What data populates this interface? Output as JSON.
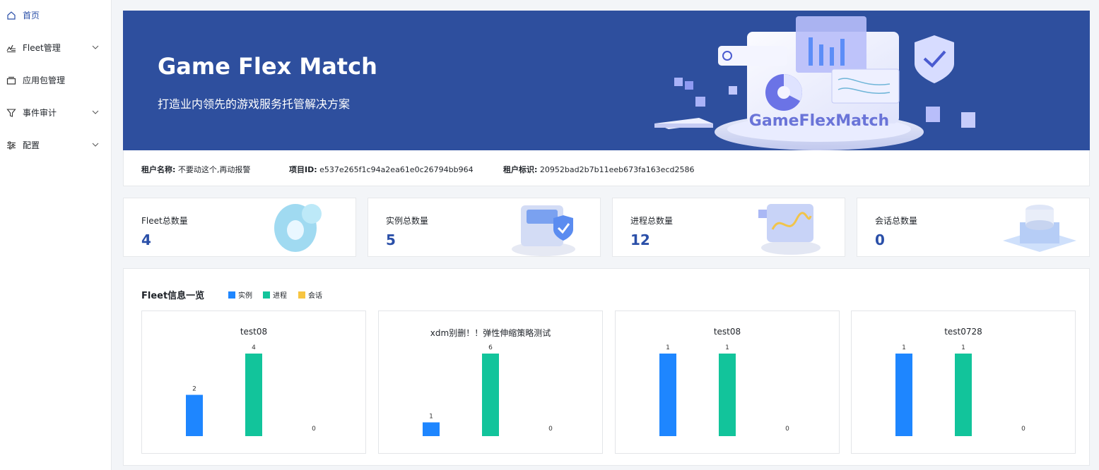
{
  "sidebar": {
    "items": [
      {
        "label": "首页",
        "icon": "home-icon",
        "active": true
      },
      {
        "label": "Fleet管理",
        "icon": "fleet-icon",
        "expandable": true
      },
      {
        "label": "应用包管理",
        "icon": "package-icon"
      },
      {
        "label": "事件审计",
        "icon": "filter-icon",
        "expandable": true
      },
      {
        "label": "配置",
        "icon": "sliders-icon",
        "expandable": true
      }
    ]
  },
  "banner": {
    "title": "Game Flex Match",
    "subtitle": "打造业内领先的游戏服务托管解决方案",
    "illustration_text": "GameFlexMatch"
  },
  "info": {
    "tenant_name_label": "租户名称:",
    "tenant_name": "不要动这个,再动报警",
    "project_id_label": "项目ID:",
    "project_id": "e537e265f1c94a2ea61e0c26794bb964",
    "tenant_id_label": "租户标识:",
    "tenant_id": "20952bad2b7b11eeb673fa163ecd2586"
  },
  "stats": [
    {
      "label": "Fleet总数量",
      "value": "4"
    },
    {
      "label": "实例总数量",
      "value": "5"
    },
    {
      "label": "进程总数量",
      "value": "12"
    },
    {
      "label": "会话总数量",
      "value": "0"
    }
  ],
  "fleet_panel": {
    "title": "Fleet信息一览",
    "legend": [
      {
        "name": "实例",
        "color": "#1e86ff"
      },
      {
        "name": "进程",
        "color": "#12c49b"
      },
      {
        "name": "会话",
        "color": "#f7c541"
      }
    ]
  },
  "chart_data": [
    {
      "type": "bar",
      "title": "test08",
      "categories": [
        "实例",
        "进程",
        "会话"
      ],
      "values": [
        2,
        4,
        0
      ]
    },
    {
      "type": "bar",
      "title": "xdm别删！！弹性伸缩策略测试",
      "categories": [
        "实例",
        "进程",
        "会话"
      ],
      "values": [
        1,
        6,
        0
      ]
    },
    {
      "type": "bar",
      "title": "test08",
      "categories": [
        "实例",
        "进程",
        "会话"
      ],
      "values": [
        1,
        1,
        0
      ]
    },
    {
      "type": "bar",
      "title": "test0728",
      "categories": [
        "实例",
        "进程",
        "会话"
      ],
      "values": [
        1,
        1,
        0
      ]
    }
  ]
}
